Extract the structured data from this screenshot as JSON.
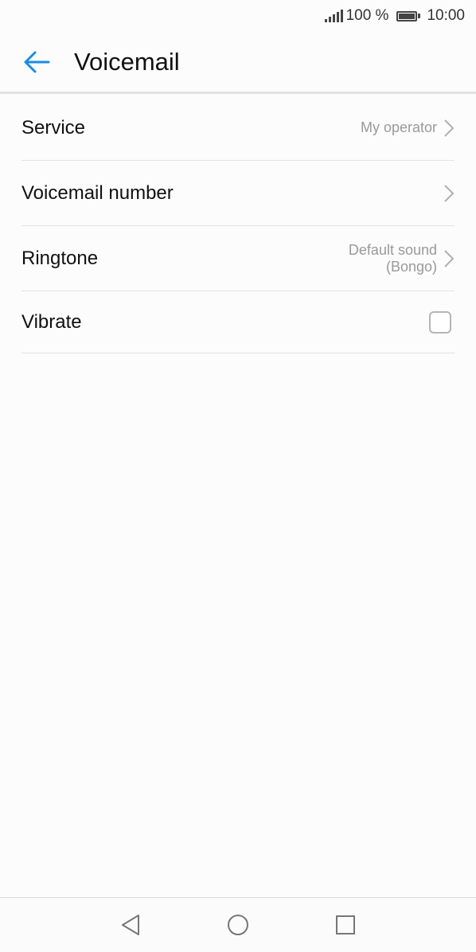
{
  "status_bar": {
    "battery_percent": "100 %",
    "time": "10:00",
    "icons": [
      "signal-icon",
      "battery-icon"
    ]
  },
  "header": {
    "title": "Voicemail",
    "back_icon": "back-arrow-icon",
    "accent_color": "#1a8be8"
  },
  "settings": [
    {
      "label": "Service",
      "value": "My operator"
    },
    {
      "label": "Voicemail number",
      "value": ""
    },
    {
      "label": "Ringtone",
      "value_line1": "Default sound",
      "value_line2": "(Bongo)"
    },
    {
      "label": "Vibrate",
      "checked": false
    }
  ],
  "nav_bar": {
    "icons": [
      "nav-back-icon",
      "nav-home-icon",
      "nav-recents-icon"
    ]
  }
}
